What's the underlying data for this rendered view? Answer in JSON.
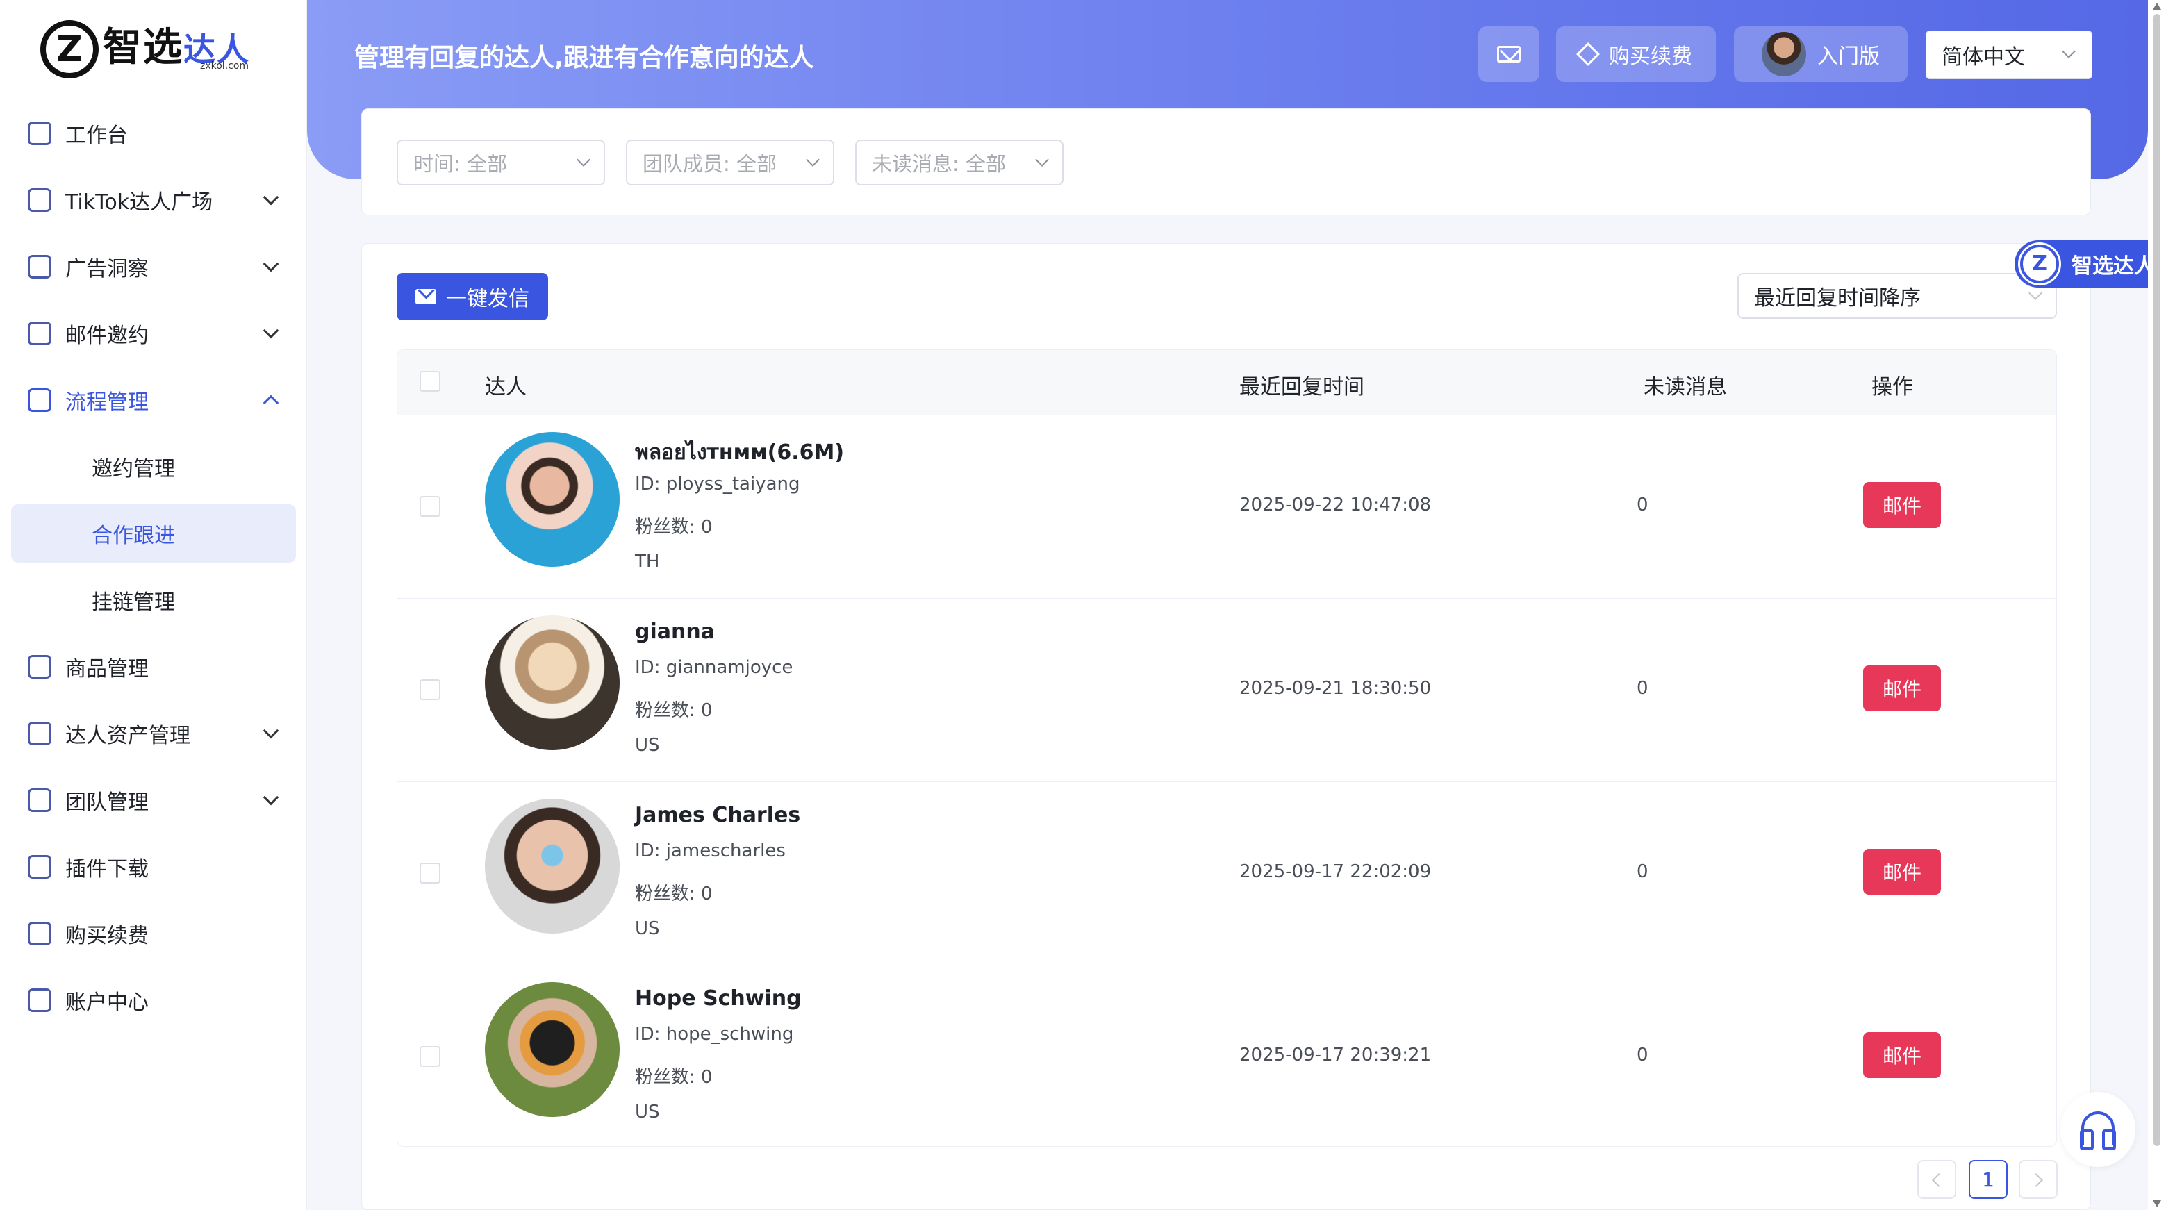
{
  "logo": {
    "main": "智选",
    "accent": "达人",
    "url": "zxkol.com"
  },
  "sidebar": {
    "items": [
      {
        "label": "工作台",
        "icon": "cube-icon",
        "expandable": false
      },
      {
        "label": "TikTok达人广场",
        "icon": "tiktok-icon",
        "expandable": true
      },
      {
        "label": "广告洞察",
        "icon": "insight-icon",
        "expandable": true
      },
      {
        "label": "邮件邀约",
        "icon": "mail-invite-icon",
        "expandable": true
      },
      {
        "label": "流程管理",
        "icon": "flow-icon",
        "expandable": true,
        "expanded": true
      },
      {
        "label": "商品管理",
        "icon": "cart-icon",
        "expandable": false
      },
      {
        "label": "达人资产管理",
        "icon": "asset-icon",
        "expandable": true
      },
      {
        "label": "团队管理",
        "icon": "team-icon",
        "expandable": true
      },
      {
        "label": "插件下载",
        "icon": "download-icon",
        "expandable": false
      },
      {
        "label": "购买续费",
        "icon": "billing-icon",
        "expandable": false
      },
      {
        "label": "账户中心",
        "icon": "account-icon",
        "expandable": false
      }
    ],
    "subitems": [
      {
        "label": "邀约管理",
        "selected": false
      },
      {
        "label": "合作跟进",
        "selected": true
      },
      {
        "label": "挂链管理",
        "selected": false
      }
    ]
  },
  "header": {
    "title": "管理有回复的达人,跟进有合作意向的达人",
    "buy_label": "购买续费",
    "plan_label": "入门版",
    "language": "简体中文"
  },
  "filters": {
    "time": "时间: 全部",
    "member": "团队成员: 全部",
    "unread": "未读消息: 全部"
  },
  "toolbar": {
    "send_all": "一键发信",
    "sort": "最近回复时间降序"
  },
  "table": {
    "headers": {
      "influencer": "达人",
      "last_reply": "最近回复时间",
      "unread": "未读消息",
      "action": "操作"
    },
    "rows": [
      {
        "name": "พลอยไงтнмм(6.6M)",
        "id": "ID: ployss_taiyang",
        "fans": "粉丝数: 0",
        "region": "TH",
        "time": "2025-09-22 10:47:08",
        "unread": "0",
        "action": "邮件"
      },
      {
        "name": "gianna",
        "id": "ID: giannamjoyce",
        "fans": "粉丝数: 0",
        "region": "US",
        "time": "2025-09-21 18:30:50",
        "unread": "0",
        "action": "邮件"
      },
      {
        "name": "James Charles",
        "id": "ID: jamescharles",
        "fans": "粉丝数: 0",
        "region": "US",
        "time": "2025-09-17 22:02:09",
        "unread": "0",
        "action": "邮件"
      },
      {
        "name": "Hope Schwing",
        "id": "ID: hope_schwing",
        "fans": "粉丝数: 0",
        "region": "US",
        "time": "2025-09-17 20:39:21",
        "unread": "0",
        "action": "邮件"
      }
    ]
  },
  "pagination": {
    "current": "1"
  },
  "float_badge": "智选达人",
  "colors": {
    "primary": "#3a56e0",
    "danger": "#e8385a",
    "header_start": "#8a9cf5",
    "header_end": "#5568e6"
  }
}
